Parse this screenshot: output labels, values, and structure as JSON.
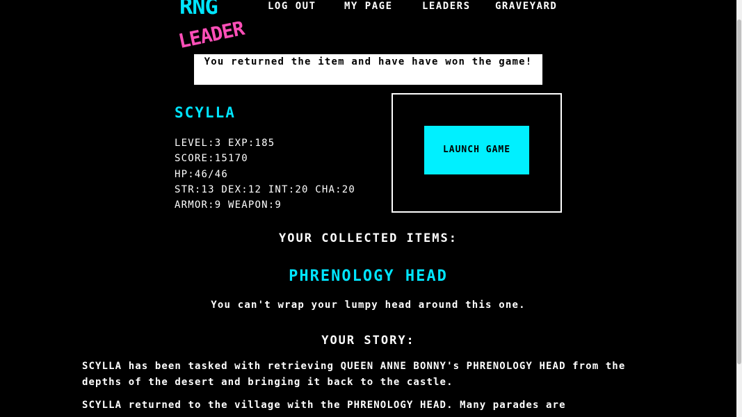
{
  "logo": {
    "text_top": "RNG",
    "text_bottom": "LEADER",
    "colors": {
      "top": "#00e5ff",
      "bottom": "#ff4fb8"
    }
  },
  "nav": {
    "items": [
      {
        "label": "LOG OUT"
      },
      {
        "label": "MY PAGE"
      },
      {
        "label": "LEADERS"
      },
      {
        "label": "GRAVEYARD"
      }
    ]
  },
  "banner": {
    "message": "You returned the item and have have won the game!"
  },
  "character": {
    "name": "SCYLLA",
    "level_line": "LEVEL:3 EXP:185",
    "score_line": "SCORE:15170",
    "hp_line": "HP:46/46",
    "attributes_line": "STR:13 DEX:12 INT:20 CHA:20",
    "gear_line": "ARMOR:9 WEAPON:9"
  },
  "game": {
    "launch_label": "LAUNCH GAME"
  },
  "items": {
    "heading": "YOUR COLLECTED ITEMS:",
    "list": [
      {
        "name": "PHRENOLOGY HEAD",
        "description": "You can't wrap your lumpy head around this one."
      }
    ]
  },
  "story": {
    "heading": "YOUR STORY:",
    "paragraphs": [
      "SCYLLA has been tasked with retrieving QUEEN ANNE BONNY's PHRENOLOGY HEAD from the depths of the desert and bringing it back to the castle.",
      "SCYLLA returned to the village with the PHRENOLOGY HEAD. Many parades are"
    ]
  },
  "colors": {
    "accent": "#00e5ff",
    "button": "#00f0ff",
    "background": "#000000",
    "banner_bg": "#ffffff",
    "logo_pink": "#ff4fb8"
  }
}
